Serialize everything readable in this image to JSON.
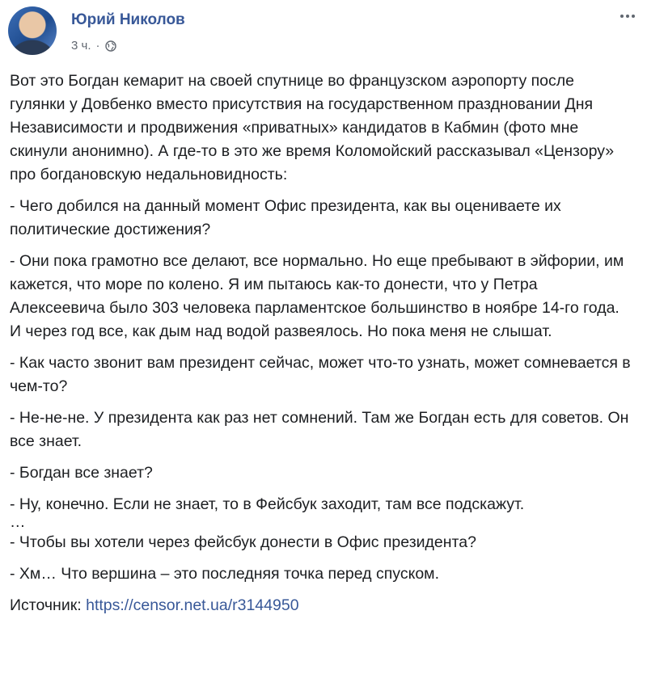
{
  "author": {
    "name": "Юрий Николов"
  },
  "post_meta": {
    "time": "3 ч.",
    "separator": "·",
    "audience_icon": "globe-icon"
  },
  "options_icon": "more-options-icon",
  "paragraphs": [
    "Вот это Богдан кемарит на своей спутнице во французском аэропорту после гулянки у Довбенко вместо присутствия на государственном праздновании Дня Независимости и продвижения «приватных» кандидатов в Кабмин (фото мне скинули анонимно). А где-то в это же время Коломойский рассказывал «Цензору» про богдановскую недальновидность:",
    "- Чего добился на данный момент Офис президента, как вы оцениваете их политические достижения?",
    "- Они пока грамотно все делают, все нормально. Но еще пребывают в эйфории, им кажется, что море по колено. Я им пытаюсь как-то донести, что у Петра Алексеевича было 303 человека парламентское большинство в ноябре 14-го года. И через год все, как дым над водой развеялось. Но пока меня не слышат.",
    "- Как часто звонит вам президент сейчас, может что-то узнать, может сомневается в чем-то?",
    "- Не-не-не. У президента как раз нет сомнений. Там же Богдан есть для советов. Он все знает.",
    "- Богдан все знает?",
    "- Ну, конечно. Если не знает, то в Фейсбук заходит, там все подскажут.",
    "…",
    "- Чтобы вы хотели через фейсбук донести в Офис президента?",
    "- Хм… Что вершина – это последняя точка перед спуском."
  ],
  "source": {
    "label": "Источник: ",
    "link_text": "https://censor.net.ua/r3144950"
  },
  "colors": {
    "link": "#385898",
    "text": "#1c1e21",
    "meta": "#616770"
  }
}
